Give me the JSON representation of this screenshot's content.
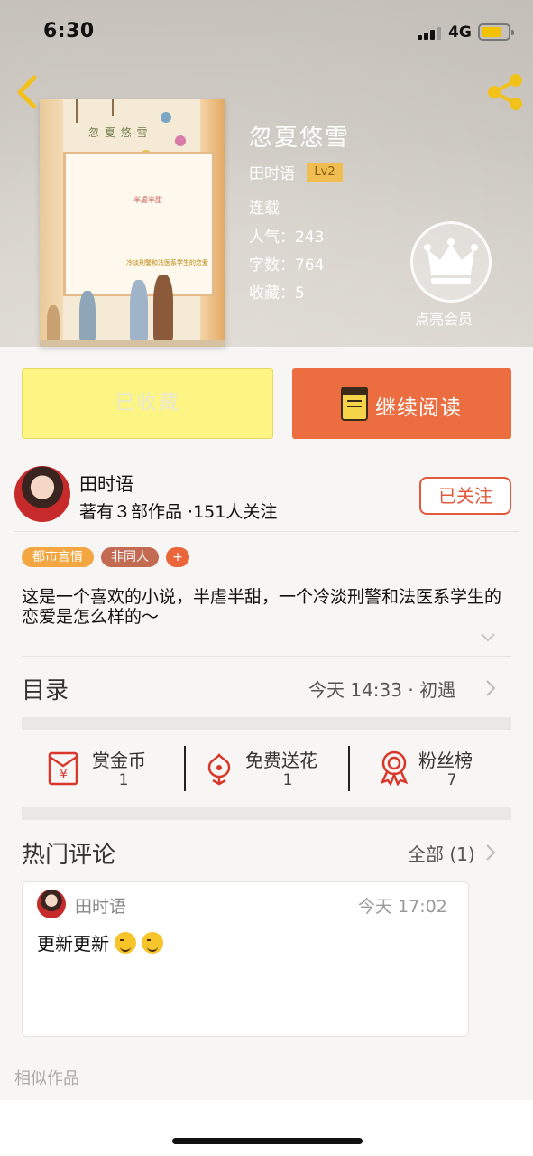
{
  "status_bar": {
    "time": "6:30",
    "network": "4G"
  },
  "book": {
    "title": "忽夏悠雪",
    "author": "田时语",
    "level": "Lv2",
    "state": "连载",
    "popularity": "人气：243",
    "word_count": "字数：764",
    "favorites": "收藏：5",
    "cover_title": "忽 夏 悠 雪",
    "cover_subtitle": "半虐半甜",
    "cover_tagline": "冷淡刑警和法医系学生的恋爱"
  },
  "vip": {
    "label": "点亮会员"
  },
  "actions": {
    "collected_label": "已收藏",
    "read_label": "继续阅读"
  },
  "author": {
    "name": "田时语",
    "meta": "著有３部作品 ·151人关注",
    "follow_label": "已关注"
  },
  "tags": [
    "都市言情",
    "非同人",
    "+"
  ],
  "description": "这是一个喜欢的小说，半虐半甜，一个冷淡刑警和法医系学生的恋爱是怎么样的～",
  "toc": {
    "label": "目录",
    "meta": "今天 14:33 · 初遇"
  },
  "stats": [
    {
      "label": "赏金币",
      "value": "1",
      "icon": "red-envelope-icon"
    },
    {
      "label": "免费送花",
      "value": "1",
      "icon": "flower-icon"
    },
    {
      "label": "粉丝榜",
      "value": "7",
      "icon": "medal-icon"
    }
  ],
  "comments_section": {
    "label": "热门评论",
    "all_label": "全部 (1)",
    "items": [
      {
        "user": "田时语",
        "time": "今天 17:02",
        "text": "更新更新"
      }
    ]
  },
  "similar_label": "相似作品",
  "colors": {
    "accent_orange": "#ec6d3f",
    "collected_yellow": "#fcf583",
    "level_badge": "#f0bd50",
    "follow_red": "#e05a3b"
  }
}
